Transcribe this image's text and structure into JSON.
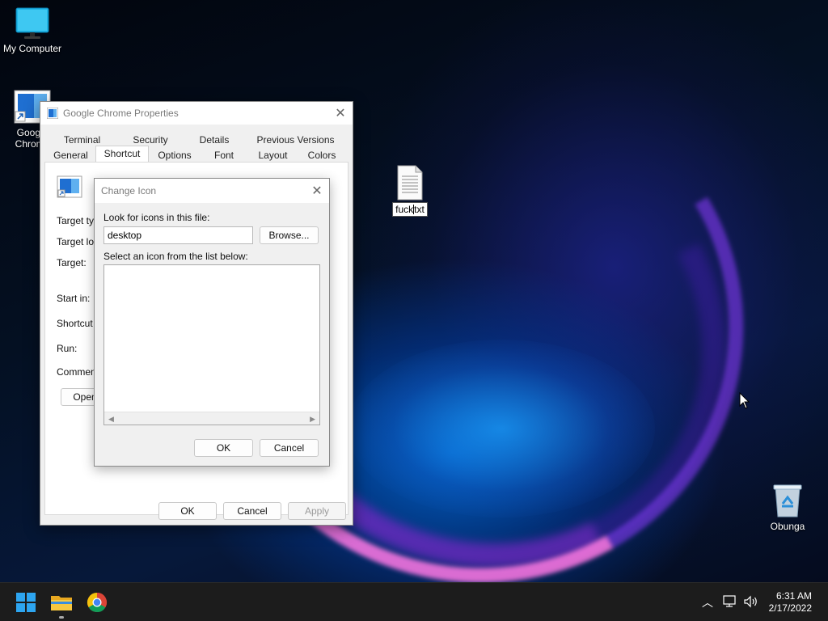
{
  "desktop": {
    "icons": {
      "my_computer": "My Computer",
      "chrome_shortcut": "Google Chrome",
      "text_file_rename": {
        "before_caret": "fuck",
        "after_caret": "txt",
        "full": "fuck.txt"
      },
      "recycle_bin": "Obunga"
    }
  },
  "properties_window": {
    "title": "Google Chrome Properties",
    "tabs_row1": [
      "Terminal",
      "Security",
      "Details",
      "Previous Versions"
    ],
    "tabs_row2": [
      "General",
      "Shortcut",
      "Options",
      "Font",
      "Layout",
      "Colors"
    ],
    "active_tab": "Shortcut",
    "labels": {
      "target_type": "Target typ",
      "target_location": "Target loc",
      "target": "Target:",
      "start_in": "Start in:",
      "shortcut_key": "Shortcut k",
      "run": "Run:",
      "comment": "Comment:",
      "open_button": "Open"
    },
    "buttons": {
      "ok": "OK",
      "cancel": "Cancel",
      "apply": "Apply"
    }
  },
  "change_icon_dialog": {
    "title": "Change Icon",
    "look_for_label": "Look for icons in this file:",
    "file_value": "desktop",
    "browse_button": "Browse...",
    "select_label": "Select an icon from the list below:",
    "buttons": {
      "ok": "OK",
      "cancel": "Cancel"
    }
  },
  "taskbar": {
    "apps": [
      "start-icon",
      "file-explorer-icon",
      "chrome-icon"
    ],
    "clock": {
      "time": "6:31 AM",
      "date": "2/17/2022"
    }
  }
}
